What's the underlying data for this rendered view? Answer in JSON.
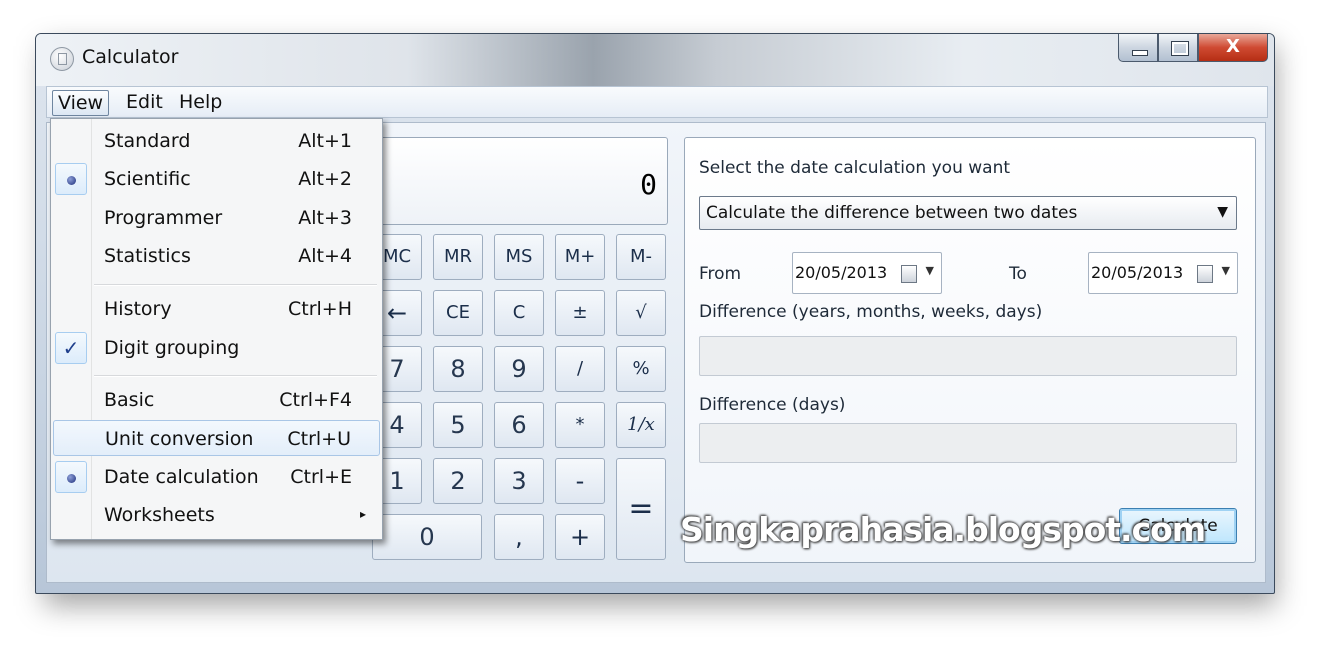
{
  "window": {
    "title": "Calculator",
    "close_glyph": "X"
  },
  "menubar": {
    "view": "View",
    "edit": "Edit",
    "help": "Help"
  },
  "display": {
    "value": "0"
  },
  "keys": {
    "mc": "MC",
    "mr": "MR",
    "ms": "MS",
    "mplus": "M+",
    "mminus": "M-",
    "back": "←",
    "ce": "CE",
    "c": "C",
    "plusminus": "±",
    "sqrt": "√",
    "seven": "7",
    "eight": "8",
    "nine": "9",
    "divide": "/",
    "percent": "%",
    "four": "4",
    "five": "5",
    "six": "6",
    "multiply": "*",
    "reciprocal": "1/x",
    "one": "1",
    "two": "2",
    "three": "3",
    "minus": "-",
    "equals": "=",
    "zero": "0",
    "decimal": ",",
    "plus": "+"
  },
  "date_panel": {
    "prompt": "Select the date calculation you want",
    "mode": "Calculate the difference between two dates",
    "from_label": "From",
    "from_date": "20/05/2013",
    "to_label": "To",
    "to_date": "20/05/2013",
    "diff_ymwd_label": "Difference (years, months, weeks, days)",
    "diff_days_label": "Difference (days)",
    "calculate": "Calculate"
  },
  "watermark": "Singkaprahasia.blogspot.com",
  "view_menu": {
    "items": [
      {
        "label": "Standard",
        "shortcut": "Alt+1"
      },
      {
        "label": "Scientific",
        "shortcut": "Alt+2",
        "mark": "radio"
      },
      {
        "label": "Programmer",
        "shortcut": "Alt+3"
      },
      {
        "label": "Statistics",
        "shortcut": "Alt+4"
      },
      {
        "label": "History",
        "shortcut": "Ctrl+H"
      },
      {
        "label": "Digit grouping",
        "shortcut": "",
        "mark": "check",
        "check_glyph": "✓"
      },
      {
        "label": "Basic",
        "shortcut": "Ctrl+F4"
      },
      {
        "label": "Unit conversion",
        "shortcut": "Ctrl+U",
        "highlighted": true
      },
      {
        "label": "Date calculation",
        "shortcut": "Ctrl+E",
        "mark": "radio"
      },
      {
        "label": "Worksheets",
        "shortcut": "",
        "submenu_glyph": "▸"
      }
    ]
  },
  "colors": {
    "accent": "#3c7fb1",
    "close_button": "#cf4a32",
    "key_text": "#1b2e4a"
  }
}
